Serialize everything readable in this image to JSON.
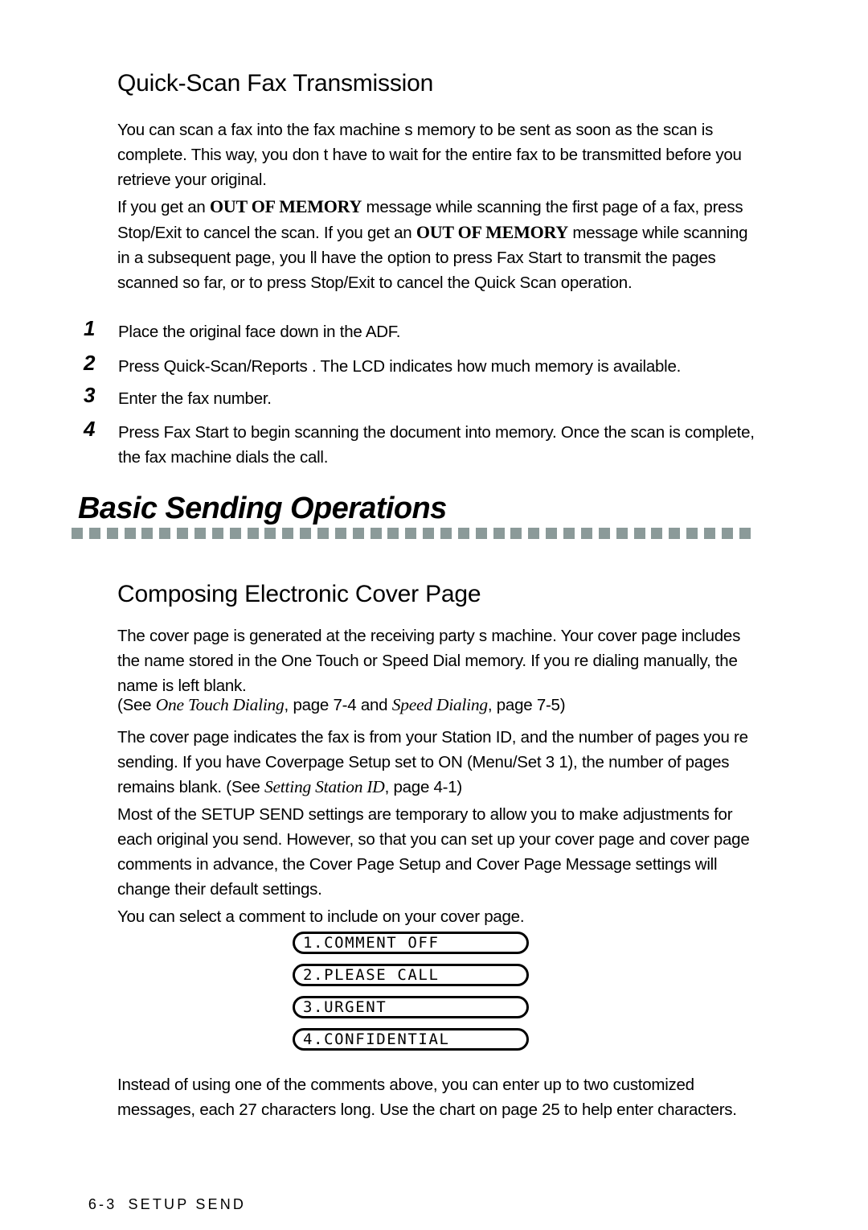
{
  "page": {
    "accent_rule_color": "#8b9a99",
    "text_color": "#000000",
    "background_color": "#ffffff"
  },
  "headings": {
    "quick_scan": "Quick-Scan Fax Transmission",
    "basic_sending": "Basic Sending Operations",
    "composing": "Composing Electronic Cover Page"
  },
  "paragraphs": {
    "p1": "You can scan a fax into the fax machine s memory to be sent as soon as the scan is complete.  This way, you don t have to wait for the entire fax to be transmitted before you retrieve your original.",
    "p2_a": "If you get an ",
    "p2_b": "OUT OF MEMORY",
    "p2_c": " message while scanning the first page of a fax, press Stop/Exit  to cancel the scan.  If you get an ",
    "p2_d": "OUT OF MEMORY",
    "p2_e": " message while scanning in a subsequent page, you ll have the option to press Fax Start  to transmit the pages scanned so far, or to press Stop/Exit  to cancel the Quick Scan operation.",
    "p3": "The cover page is generated at the receiving party s machine. Your cover page includes the name stored in the One Touch or Speed Dial memory. If you re dialing manually, the name is left blank.",
    "xref_a": "(See ",
    "xref_b": "One Touch Dialing",
    "xref_c": ", page 7-4 and ",
    "xref_d": "Speed Dialing",
    "xref_e": ", page 7-5)",
    "p4_a": "The cover page indicates the fax is from your Station ID, and the number of pages you re sending. If you have Coverpage Setup set to ON (Menu/Set 3 1), the number of pages remains blank. (See ",
    "p4_b": "Setting Station ID",
    "p4_c": ", page 4-1)",
    "p5": "Most of the SETUP SEND settings are temporary to allow you to make adjustments for each original you send. However, so that you can set up your cover page and cover page comments in advance, the Cover Page Setup and Cover Page Message settings will change their default settings.",
    "p6": "You can select a comment to include on your cover page.",
    "p7": "Instead of using one of the comments above, you can enter up to two customized messages, each 27 characters long. Use the chart on page 25 to help enter characters."
  },
  "steps": [
    {
      "num": "1",
      "text": "Place the original face down in the ADF."
    },
    {
      "num": "2",
      "text": "Press Quick-Scan/Reports  .  The LCD indicates how much memory is available."
    },
    {
      "num": "3",
      "text": "Enter the fax number."
    },
    {
      "num": "4",
      "text": "Press Fax Start  to begin scanning the document into memory.  Once the scan is complete, the fax machine dials the call."
    }
  ],
  "lcd_options": [
    {
      "label": "1.COMMENT OFF"
    },
    {
      "label": "2.PLEASE CALL"
    },
    {
      "label": "3.URGENT"
    },
    {
      "label": "4.CONFIDENTIAL"
    }
  ],
  "footer": {
    "page_number": "6-3",
    "section": "SETUP SEND"
  }
}
